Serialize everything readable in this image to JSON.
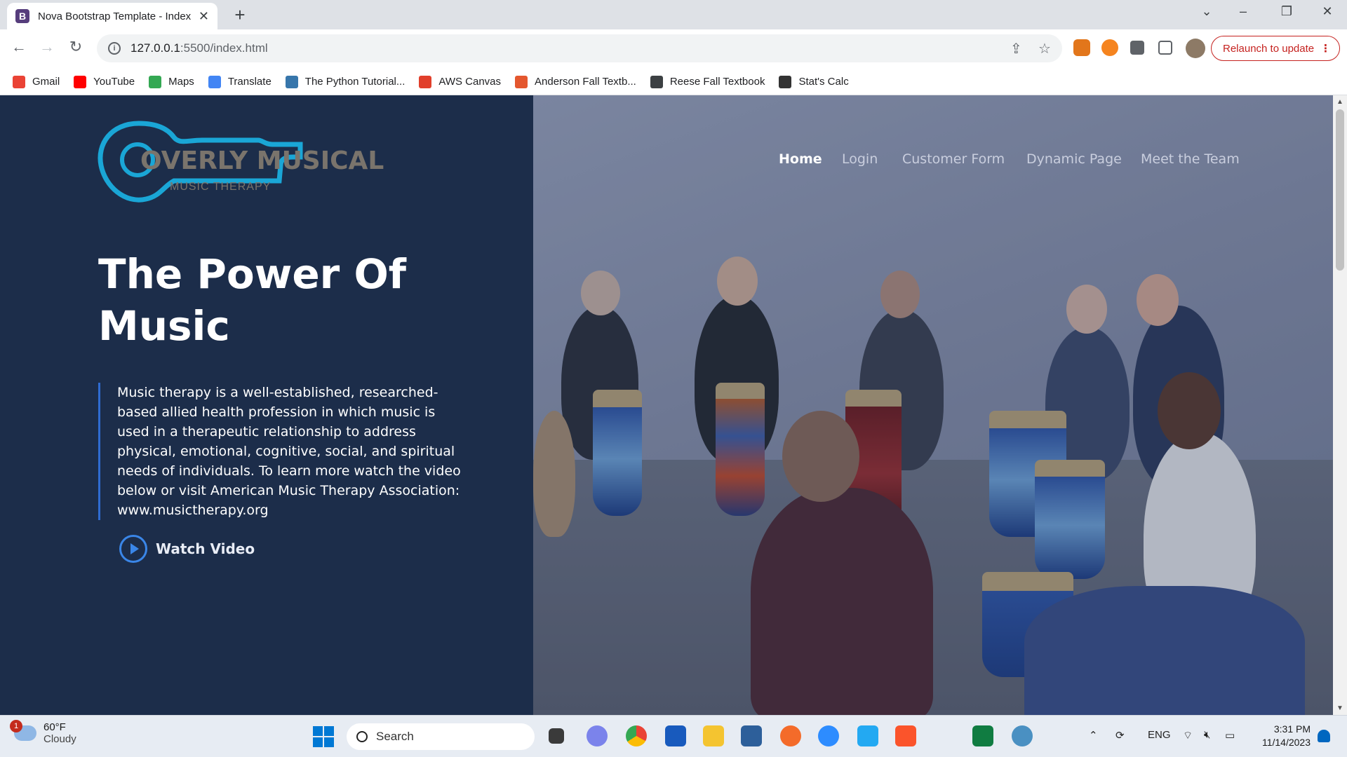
{
  "browser": {
    "tab_title": "Nova Bootstrap Template - Index",
    "tab_favicon": "B",
    "url_host": "127.0.0.1",
    "url_path": ":5500/index.html",
    "relaunch_label": "Relaunch to update",
    "bookmarks": [
      {
        "label": "Gmail",
        "icon": "gmail-icon",
        "color": "#ea4335"
      },
      {
        "label": "YouTube",
        "icon": "youtube-icon",
        "color": "#ff0000"
      },
      {
        "label": "Maps",
        "icon": "maps-icon",
        "color": "#34a853"
      },
      {
        "label": "Translate",
        "icon": "translate-icon",
        "color": "#4285f4"
      },
      {
        "label": "The Python Tutorial...",
        "icon": "python-icon",
        "color": "#3776ab"
      },
      {
        "label": "AWS Canvas",
        "icon": "canvas-icon",
        "color": "#e13f2b"
      },
      {
        "label": "Anderson Fall Textb...",
        "icon": "mheducation-icon",
        "color": "#e4572e"
      },
      {
        "label": "Reese Fall Textbook",
        "icon": "globe-icon",
        "color": "#3c4043"
      },
      {
        "label": "Stat's Calc",
        "icon": "calculator-icon",
        "color": "#333333"
      }
    ]
  },
  "site": {
    "logo_text": "OVERLY MUSICAL",
    "logo_subtext": "MUSIC THERAPY",
    "nav": [
      "Home",
      "Login",
      "Customer Form",
      "Dynamic Page",
      "Meet the Team"
    ],
    "hero_title": "The Power Of Music",
    "hero_text": "Music therapy is a well-established, researched-based allied health profession in which music is used in a therapeutic relationship to address physical, emotional, cognitive, social, and spiritual needs of individuals. To learn more watch the video below or visit American Music Therapy Association: www.musictherapy.org",
    "watch_label": "Watch Video",
    "colors": {
      "panel": "#1c2d4a",
      "accent": "#3a86e8",
      "logo_blue": "#1aa6d6"
    }
  },
  "taskbar": {
    "weather_temp": "60°F",
    "weather_desc": "Cloudy",
    "weather_badge": "1",
    "search_label": "Search",
    "lang": "ENG",
    "time": "3:31 PM",
    "date": "11/14/2023"
  }
}
